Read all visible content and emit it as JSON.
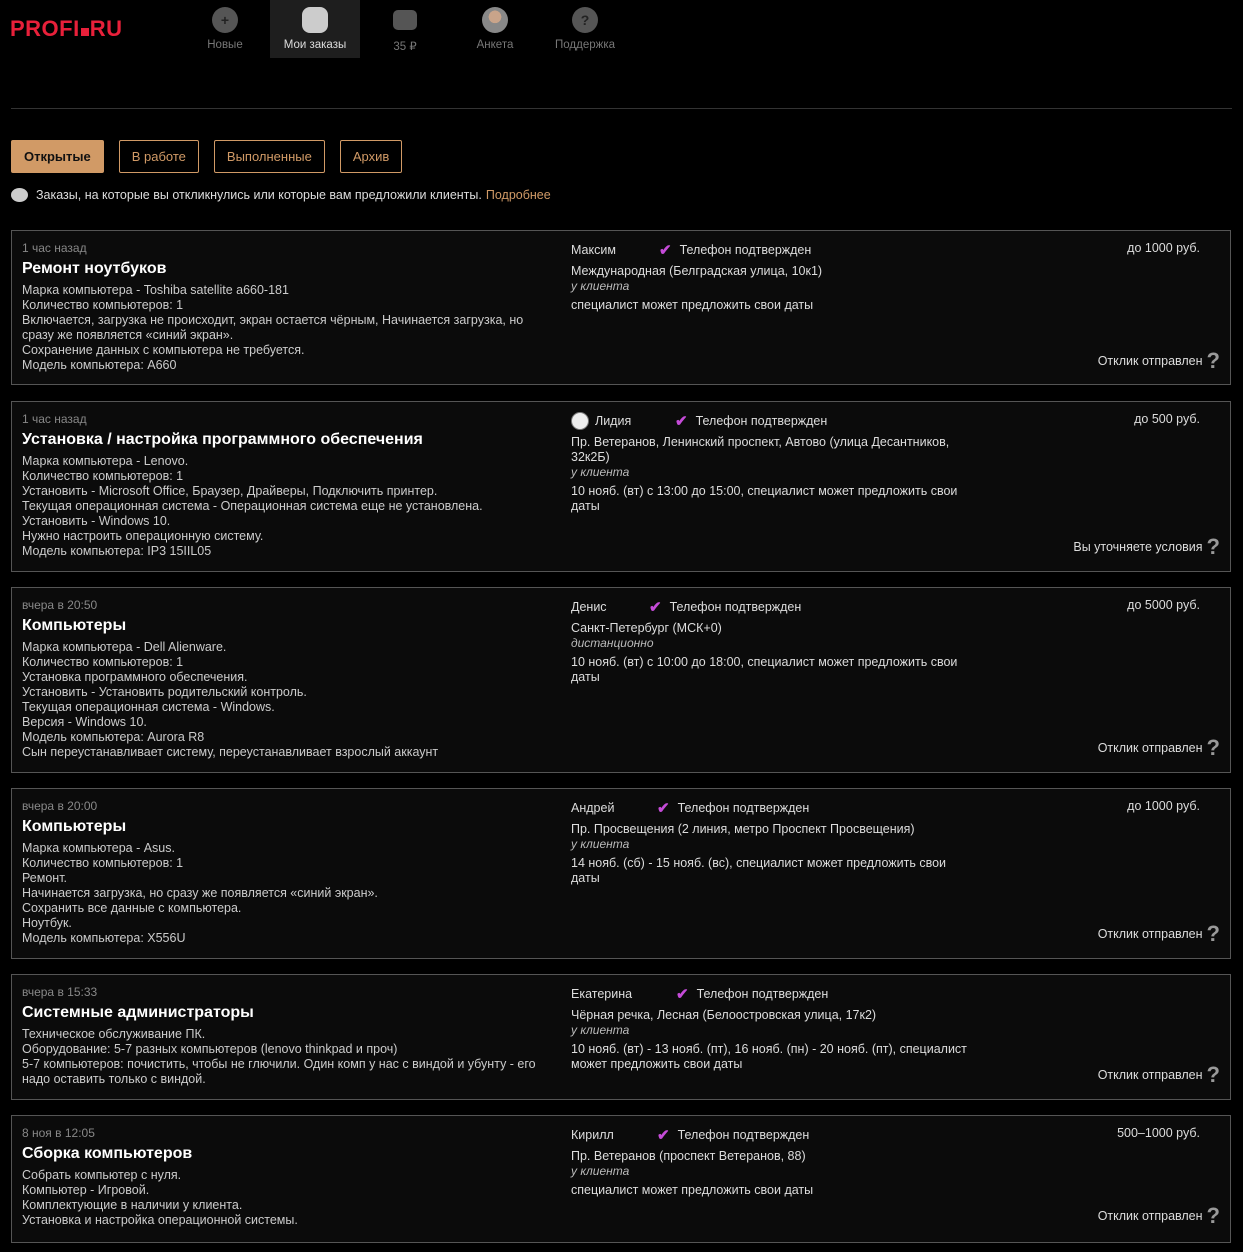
{
  "logo": {
    "left": "PROFI",
    "right": "RU"
  },
  "nav": [
    {
      "label": "Новые",
      "icon": "plus-stack-icon",
      "glyph": "+"
    },
    {
      "label": "Мои заказы",
      "icon": "chat-bubbles-icon",
      "glyph": "",
      "active": true
    },
    {
      "label": "35 ₽",
      "icon": "wallet-icon",
      "glyph": ""
    },
    {
      "label": "Анкета",
      "icon": "avatar-icon",
      "glyph": ""
    },
    {
      "label": "Поддержка",
      "icon": "help-icon",
      "glyph": "?"
    }
  ],
  "tabs": [
    {
      "label": "Открытые",
      "active": true
    },
    {
      "label": "В работе"
    },
    {
      "label": "Выполненные"
    },
    {
      "label": "Архив"
    }
  ],
  "info": {
    "text": "Заказы, на которые вы откликнулись или которые вам предложили клиенты.",
    "link": "Подробнее"
  },
  "orders": [
    {
      "time": "1 час назад",
      "title": "Ремонт ноутбуков",
      "desc": [
        "Марка компьютера - Toshiba satellite a660-181",
        "Количество компьютеров: 1",
        "Включается, загрузка не происходит, экран остается чёрным, Начинается загрузка, но",
        "сразу же появляется «синий экран».",
        "Сохранение данных с компьютера не требуется.",
        "Модель компьютера: A660"
      ],
      "client": "Максим",
      "phone": "Телефон подтвержден",
      "address": [
        "Международная (Белградская улица, 10к1)"
      ],
      "place": "у клиента",
      "dates": [
        "специалист может предложить свои даты"
      ],
      "price": "до 1000 руб.",
      "status": "Отклик отправлен"
    },
    {
      "time": "1 час назад",
      "title": "Установка / настройка программного обеспечения",
      "desc": [
        "Марка компьютера - Lenovo.",
        "Количество компьютеров: 1",
        "Установить - Microsoft Office, Браузер, Драйверы, Подключить принтер.",
        "Текущая операционная система - Операционная система еще не установлена.",
        "Установить - Windows 10.",
        "Нужно настроить операционную систему.",
        "Модель компьютера: IP3 15IIL05"
      ],
      "client": "Лидия",
      "phone": "Телефон подтвержден",
      "address": [
        "Пр. Ветеранов, Ленинский проспект, Автово (улица Десантников,",
        "32к2Б)"
      ],
      "place": "у клиента",
      "dates": [
        "10 нояб. (вт) с 13:00 до 15:00, специалист может предложить свои",
        "даты"
      ],
      "price": "до 500 руб.",
      "status": "Вы уточняете условия"
    },
    {
      "time": "вчера в 20:50",
      "title": "Компьютеры",
      "desc": [
        "Марка компьютера - Dell Alienware.",
        "Количество компьютеров: 1",
        "Установка программного обеспечения.",
        "Установить - Установить родительский контроль.",
        "Текущая операционная система - Windows.",
        "Версия - Windows 10.",
        "Модель компьютера: Aurora R8",
        "Сын переустанавливает систему, переустанавливает взрослый аккаунт"
      ],
      "client": "Денис",
      "phone": "Телефон подтвержден",
      "address": [
        "Санкт-Петербург (МСК+0)"
      ],
      "place": "дистанционно",
      "dates": [
        "10 нояб. (вт) с 10:00 до 18:00, специалист может предложить свои",
        "даты"
      ],
      "price": "до 5000 руб.",
      "status": "Отклик отправлен"
    },
    {
      "time": "вчера в 20:00",
      "title": "Компьютеры",
      "desc": [
        "Марка компьютера - Asus.",
        "Количество компьютеров: 1",
        "Ремонт.",
        "Начинается загрузка, но сразу же появляется «синий экран».",
        "Сохранить все данные с компьютера.",
        "Ноутбук.",
        "Модель компьютера: X556U"
      ],
      "client": "Андрей",
      "phone": "Телефон подтвержден",
      "address": [
        "Пр. Просвещения (2 линия, метро Проспект Просвещения)"
      ],
      "place": "у клиента",
      "dates": [
        "14 нояб. (сб) - 15 нояб. (вс), специалист может предложить свои",
        "даты"
      ],
      "price": "до 1000 руб.",
      "status": "Отклик отправлен"
    },
    {
      "time": "вчера в 15:33",
      "title": "Системные администраторы",
      "desc": [
        "Техническое обслуживание ПК.",
        "Оборудование: 5-7 разных компьютеров (lenovo thinkpad и проч)",
        "5-7 компьютеров: почистить, чтобы не глючили. Один комп у нас с виндой и убунту - его",
        "надо оставить только с виндой."
      ],
      "client": "Екатерина",
      "phone": "Телефон подтвержден",
      "address": [
        "Чёрная речка, Лесная (Белоостровская улица, 17к2)"
      ],
      "place": "у клиента",
      "dates": [
        "10 нояб. (вт) - 13 нояб. (пт), 16 нояб. (пн) - 20 нояб. (пт), специалист",
        "может предложить свои даты"
      ],
      "price": "",
      "status": "Отклик отправлен"
    },
    {
      "time": "8 ноя в 12:05",
      "title": "Сборка компьютеров",
      "desc": [
        "Собрать компьютер с нуля.",
        "Компьютер - Игровой.",
        "Комплектующие в наличии у клиента.",
        "Установка и настройка операционной системы."
      ],
      "client": "Кирилл",
      "phone": "Телефон подтвержден",
      "address": [
        "Пр. Ветеранов (проспект Ветеранов, 88)"
      ],
      "place": "у клиента",
      "dates": [
        "специалист может предложить свои даты"
      ],
      "price": "500–1000 руб.",
      "status": "Отклик отправлен"
    }
  ]
}
